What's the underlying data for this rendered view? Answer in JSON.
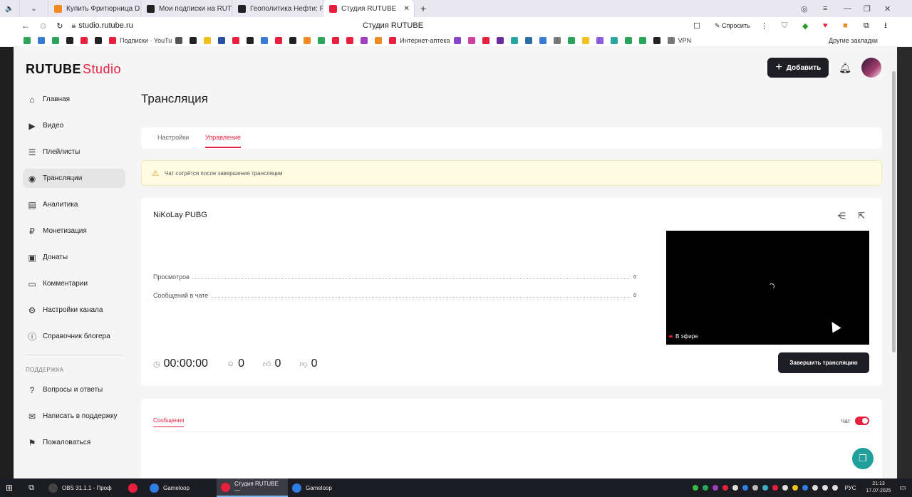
{
  "browser": {
    "tabs": [
      {
        "label": "Купить Фритюрница DEX",
        "color": "#f08a24"
      },
      {
        "label": "Мои подписки на RUTUB",
        "color": "#222"
      },
      {
        "label": "Геополитика Нефти: Росс",
        "color": "#222"
      },
      {
        "label": "Студия RUTUBE",
        "color": "#e8203e",
        "active": true
      }
    ],
    "new_tab": "+",
    "address": "studio.rutube.ru",
    "page_title": "Студия RUTUBE",
    "ask_label": "Спросить",
    "bookmarks": [
      {
        "label": "Подписки · YouTu",
        "color": "#e8203e"
      },
      {
        "label": "Интернет-аптека",
        "color": "#e8203e"
      },
      {
        "label": "VPN",
        "color": "#777"
      }
    ],
    "other_bookmarks": "Другие закладки"
  },
  "app": {
    "logo": {
      "brand": "RUTUBE",
      "suffix": "Studio"
    },
    "add_button": "Добавить",
    "nav": [
      {
        "label": "Главная",
        "icon": "home-icon",
        "glyph": "⌂"
      },
      {
        "label": "Видео",
        "icon": "video-icon",
        "glyph": "▶"
      },
      {
        "label": "Плейлисты",
        "icon": "playlist-icon",
        "glyph": "☰"
      },
      {
        "label": "Трансляции",
        "icon": "broadcast-icon",
        "glyph": "◉",
        "active": true
      },
      {
        "label": "Аналитика",
        "icon": "analytics-icon",
        "glyph": "▤"
      },
      {
        "label": "Монетизация",
        "icon": "monetization-icon",
        "glyph": "₽"
      },
      {
        "label": "Донаты",
        "icon": "wallet-icon",
        "glyph": "▣"
      },
      {
        "label": "Комментарии",
        "icon": "comments-icon",
        "glyph": "▭"
      },
      {
        "label": "Настройки канала",
        "icon": "gear-icon",
        "glyph": "⚙"
      },
      {
        "label": "Справочник блогера",
        "icon": "info-icon",
        "glyph": "ⓘ"
      }
    ],
    "support_title": "ПОДДЕРЖКА",
    "support": [
      {
        "label": "Вопросы и ответы",
        "icon": "question-icon",
        "glyph": "?"
      },
      {
        "label": "Написать в поддержку",
        "icon": "mail-icon",
        "glyph": "✉"
      },
      {
        "label": "Пожаловаться",
        "icon": "flag-icon",
        "glyph": "⚑"
      }
    ],
    "page_title": "Трансляция",
    "tabs": {
      "settings": "Настройки",
      "manage": "Управление"
    },
    "notice": "Чат сотрётся после завершения трансляции",
    "stream": {
      "title": "NiKoLay PUBG",
      "views_label": "Просмотров",
      "views_value": "0",
      "chat_label": "Сообщений в чате",
      "chat_value": "0",
      "live_label": "В эфире",
      "timer": "00:00:00",
      "viewers": "0",
      "likes": "0",
      "dislikes": "0",
      "end_button": "Завершить трансляцию"
    },
    "chat": {
      "tab": "Сообщения",
      "toggle_label": "Чат",
      "enabled": true
    }
  },
  "taskbar": {
    "items": [
      {
        "label": "OBS 31.1.1 - Проф",
        "color": "#444"
      },
      {
        "label": "",
        "color": "#e8203e"
      },
      {
        "label": "Gameloop",
        "color": "#2f7de1"
      },
      {
        "label": "Студия RUTUBE —",
        "color": "#e8203e",
        "active": true
      },
      {
        "label": "Gameloop",
        "color": "#2f7de1"
      }
    ],
    "lang": "РУС",
    "time": "21:13",
    "date": "17.07.2025"
  },
  "colors": {
    "accent": "#e8203e",
    "dark_button": "#1d1f24",
    "notice_bg": "#fffbe3",
    "fab": "#1f9e9a"
  }
}
